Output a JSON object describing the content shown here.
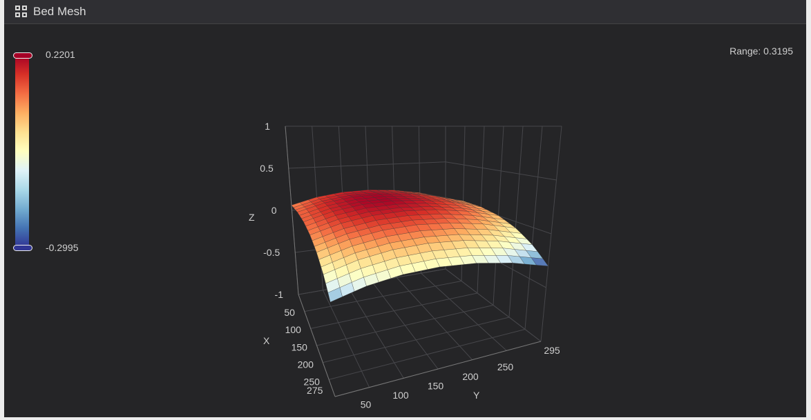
{
  "header": {
    "title": "Bed Mesh",
    "icon": "grid-icon"
  },
  "range_label": "Range: 0.3195",
  "colorbar": {
    "max_label": "0.2201",
    "min_label": "-0.2995",
    "colors": [
      "#a50026",
      "#f46d43",
      "#fee090",
      "#ffffbf",
      "#e0f3f8",
      "#74add1",
      "#313695"
    ]
  },
  "chart_data": {
    "type": "surface",
    "xlabel": "X",
    "ylabel": "Y",
    "zlabel": "Z",
    "x_ticks": [
      "50",
      "100",
      "150",
      "200",
      "250",
      "275"
    ],
    "y_ticks": [
      "50",
      "100",
      "150",
      "200",
      "250",
      "295"
    ],
    "z_ticks": [
      "1",
      "0.5",
      "0",
      "-0.5",
      "-1"
    ],
    "x_range": [
      0,
      295
    ],
    "y_range": [
      0,
      295
    ],
    "z_range": [
      -1,
      1
    ],
    "x": [
      0,
      49,
      98,
      148,
      197,
      246,
      295
    ],
    "y": [
      0,
      49,
      98,
      148,
      197,
      246,
      295
    ],
    "z": [
      [
        0.061,
        0.135,
        0.174,
        0.181,
        0.155,
        0.095,
        0.001
      ],
      [
        0.094,
        0.168,
        0.208,
        0.214,
        0.188,
        0.128,
        0.034
      ],
      [
        0.094,
        0.168,
        0.208,
        0.214,
        0.188,
        0.128,
        0.034
      ],
      [
        0.061,
        0.135,
        0.174,
        0.181,
        0.155,
        0.095,
        0.001
      ],
      [
        -0.006,
        0.068,
        0.108,
        0.115,
        0.088,
        0.028,
        -0.066
      ],
      [
        -0.106,
        -0.032,
        0.008,
        0.015,
        -0.012,
        -0.072,
        -0.166
      ],
      [
        -0.239,
        -0.166,
        -0.126,
        -0.119,
        -0.146,
        -0.206,
        -0.2995
      ]
    ],
    "cmin": -0.2995,
    "cmax": 0.2201,
    "grid": true
  }
}
